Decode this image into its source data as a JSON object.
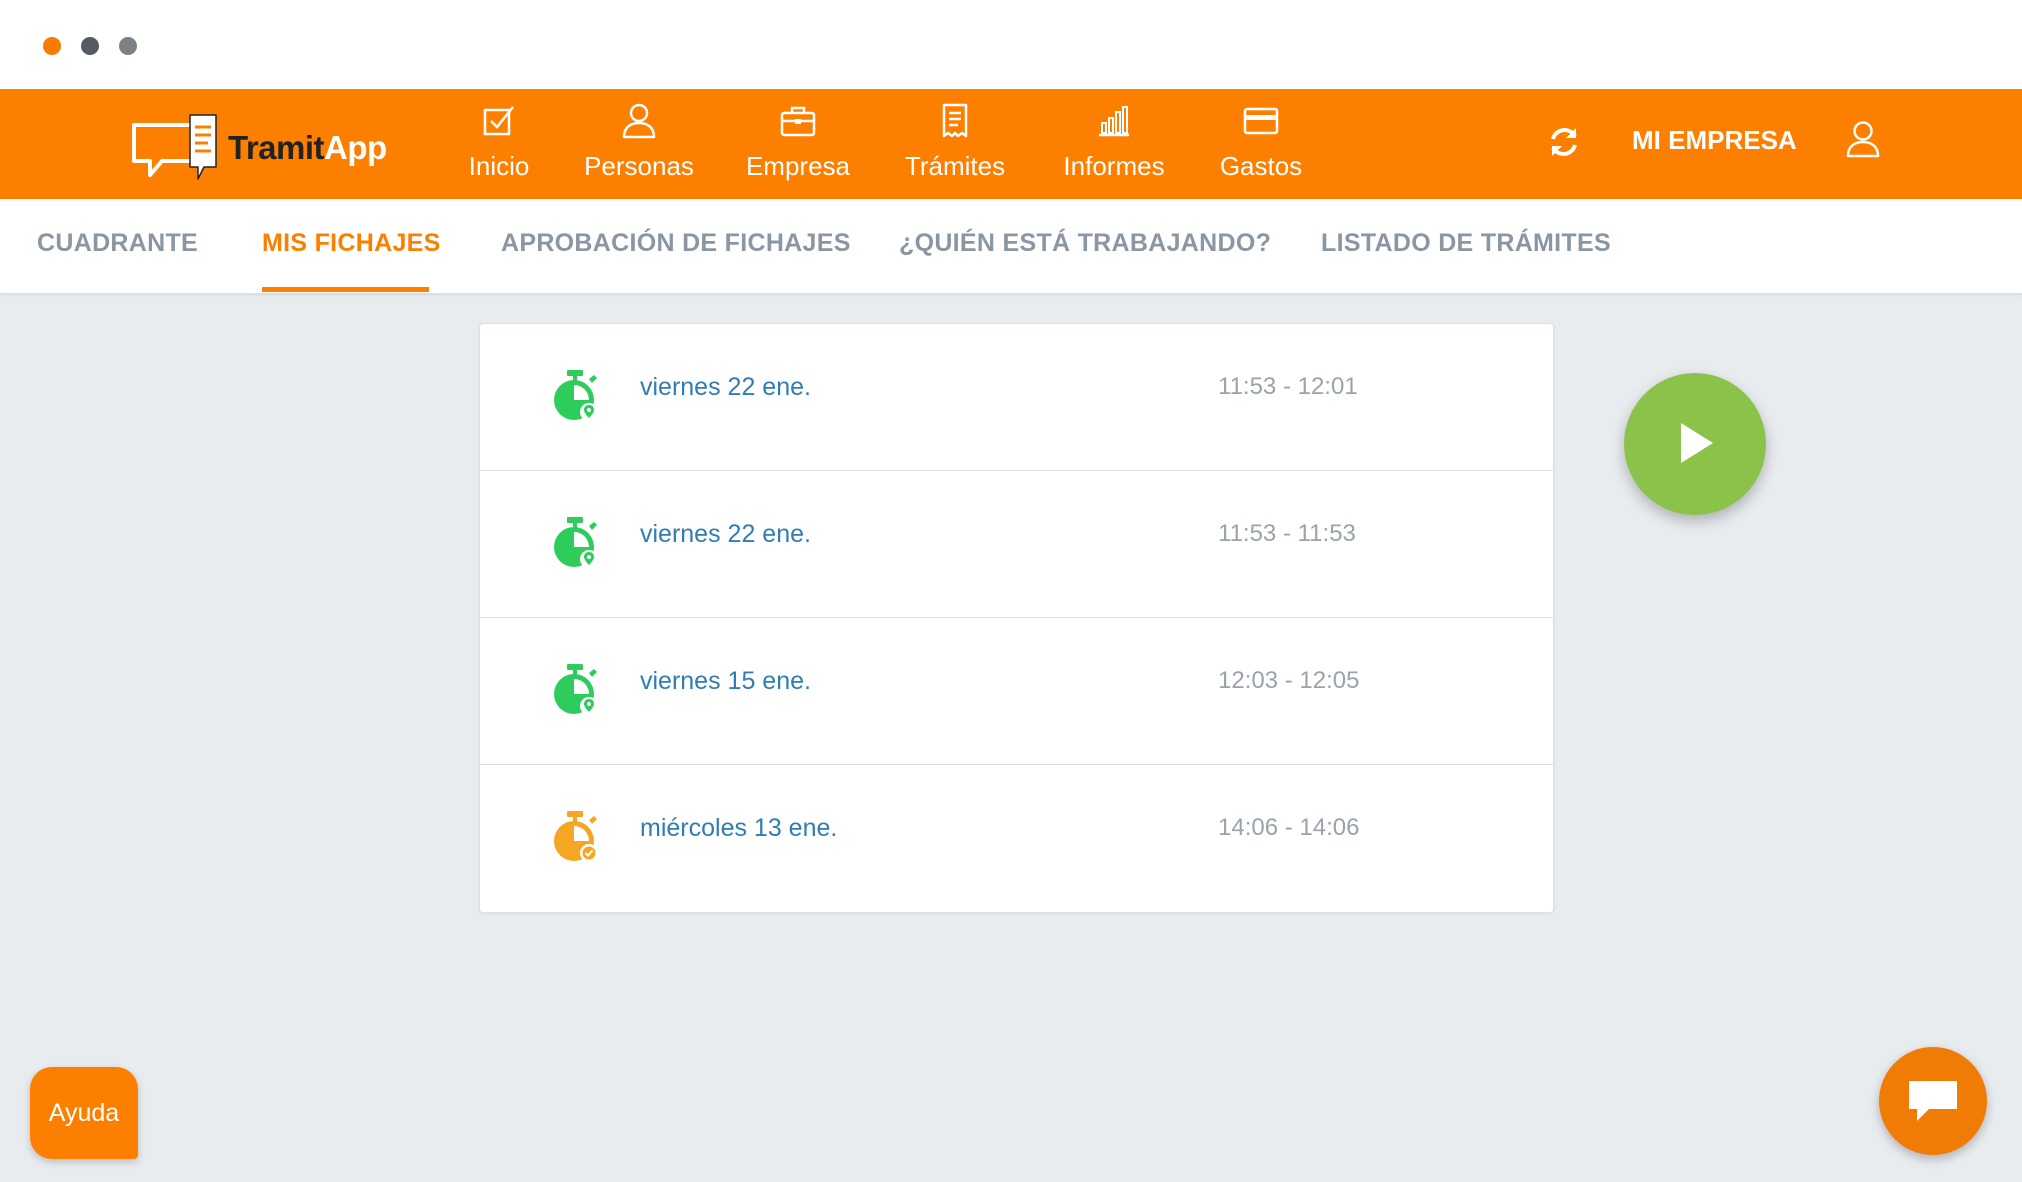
{
  "window": {
    "controls": [
      "close",
      "minimize",
      "maximize"
    ]
  },
  "brand": {
    "name_part1": "Tramit",
    "name_part2": "App"
  },
  "nav": {
    "items": [
      {
        "label": "Inicio",
        "icon": "checkbox-icon"
      },
      {
        "label": "Personas",
        "icon": "person-icon"
      },
      {
        "label": "Empresa",
        "icon": "briefcase-icon"
      },
      {
        "label": "Trámites",
        "icon": "receipt-icon"
      },
      {
        "label": "Informes",
        "icon": "bar-chart-icon"
      },
      {
        "label": "Gastos",
        "icon": "credit-card-icon"
      }
    ],
    "company": "MI EMPRESA",
    "refresh_icon": "refresh-icon",
    "user_icon": "user-icon"
  },
  "subtabs": {
    "items": [
      "CUADRANTE",
      "MIS FICHAJES",
      "APROBACIÓN DE FICHAJES",
      "¿QUIÉN ESTÁ TRABAJANDO?",
      "LISTADO DE TRÁMITES"
    ],
    "active": "MIS FICHAJES"
  },
  "fichajes": [
    {
      "date": "viernes 22 ene.",
      "time": "11:53 - 12:01",
      "status": "location",
      "color": "#2ecc5b"
    },
    {
      "date": "viernes 22 ene.",
      "time": "11:53 - 11:53",
      "status": "location",
      "color": "#2ecc5b"
    },
    {
      "date": "viernes 15 ene.",
      "time": "12:03 - 12:05",
      "status": "location",
      "color": "#2ecc5b"
    },
    {
      "date": "miércoles 13 ene.",
      "time": "14:06 - 14:06",
      "status": "check",
      "color": "#f5a623"
    }
  ],
  "actions": {
    "play_icon": "play-icon",
    "help_label": "Ayuda",
    "chat_icon": "chat-icon"
  },
  "colors": {
    "brand_orange": "#fd7f00",
    "play_green": "#8bc34a",
    "link_blue": "#2f7db3",
    "background": "#e9ecef"
  }
}
